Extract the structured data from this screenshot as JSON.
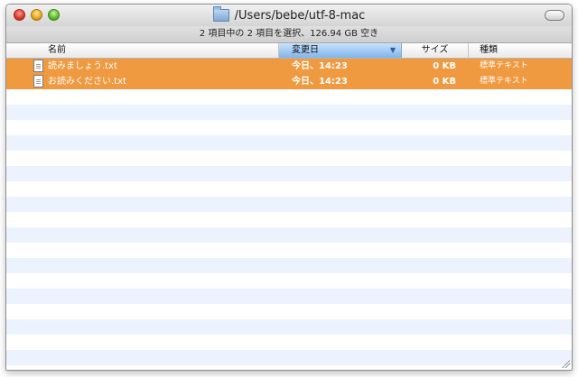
{
  "window": {
    "title": "/Users/bebe/utf-8-mac",
    "status": "2 項目中の 2 項目を選択、126.94 GB 空き"
  },
  "columns": {
    "name": "名前",
    "date": "変更日",
    "size": "サイズ",
    "kind": "種類"
  },
  "files": [
    {
      "name": "読みましょう.txt",
      "date": "今日、14:23",
      "size": "0 KB",
      "kind": "標準テキスト"
    },
    {
      "name": "お読みください.txt",
      "date": "今日、14:23",
      "size": "0 KB",
      "kind": "標準テキスト"
    }
  ],
  "colors": {
    "selection": "#ef9940",
    "sorted_header": "#7fb5ec",
    "stripe": "#edf3fe"
  },
  "icons": {
    "close": "close-icon",
    "minimize": "minimize-icon",
    "zoom": "zoom-icon",
    "folder": "folder-icon",
    "file": "text-file-icon",
    "sort": "sort-descending-icon",
    "resize": "resize-grip-icon"
  }
}
